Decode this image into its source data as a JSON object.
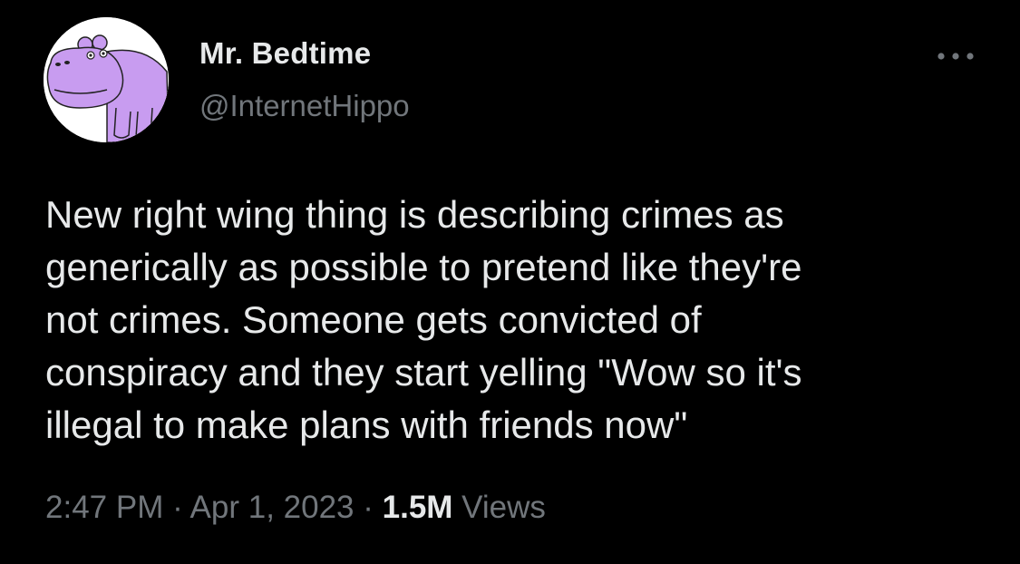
{
  "tweet": {
    "author": {
      "display_name": "Mr. Bedtime",
      "handle": "@InternetHippo",
      "avatar_icon": "purple-hippo-avatar"
    },
    "text": "New right wing thing is describing crimes as\ngenerically as possible to pretend like they're\nnot crimes. Someone gets convicted of\nconspiracy and they start yelling \"Wow so it's\nillegal to make plans with friends now\"",
    "time": "2:47 PM",
    "separator": " · ",
    "date": "Apr 1, 2023",
    "views_count": "1.5M",
    "views_label": "Views",
    "more_icon": "more-horizontal-icon"
  },
  "colors": {
    "background": "#000000",
    "primary_text": "#e7e9ea",
    "secondary_text": "#71767b",
    "avatar_purple": "#c89cf0"
  }
}
